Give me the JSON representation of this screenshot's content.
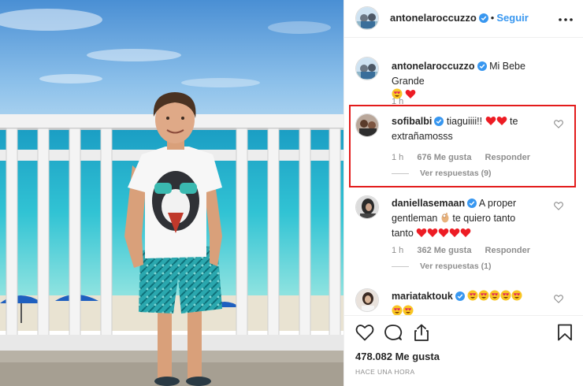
{
  "post": {
    "author": "antonelaroccuzzo",
    "follow_label": "Seguir",
    "dot": "•",
    "more_label": "•••",
    "caption_author": "antonelaroccuzzo",
    "caption_text": "Mi Bebe Grande",
    "caption_time": "1 h",
    "likes": "478.082 Me gusta",
    "time_ago": "HACE UNA HORA"
  },
  "comments": [
    {
      "user": "sofibalbi",
      "text": "tiaguiiii!!",
      "text2": "te",
      "text3": "extrañamosss",
      "time": "1 h",
      "likes": "676 Me gusta",
      "reply": "Responder",
      "view_replies": "Ver respuestas (9)"
    },
    {
      "user": "daniellasemaan",
      "text": "A proper",
      "text2": "gentleman",
      "text3": "te quiero tanto",
      "text4": "tanto",
      "time": "1 h",
      "likes": "362 Me gusta",
      "reply": "Responder",
      "view_replies": "Ver respuestas (1)"
    },
    {
      "user": "mariataktouk"
    }
  ],
  "colors": {
    "accent": "#3897f0",
    "highlight": "#e31b1b",
    "verified": "#3897f0",
    "heart_red": "#ed1c24"
  },
  "icons": [
    "verified-badge-icon",
    "heart-icon",
    "comment-icon",
    "share-icon",
    "bookmark-icon",
    "more-icon"
  ]
}
